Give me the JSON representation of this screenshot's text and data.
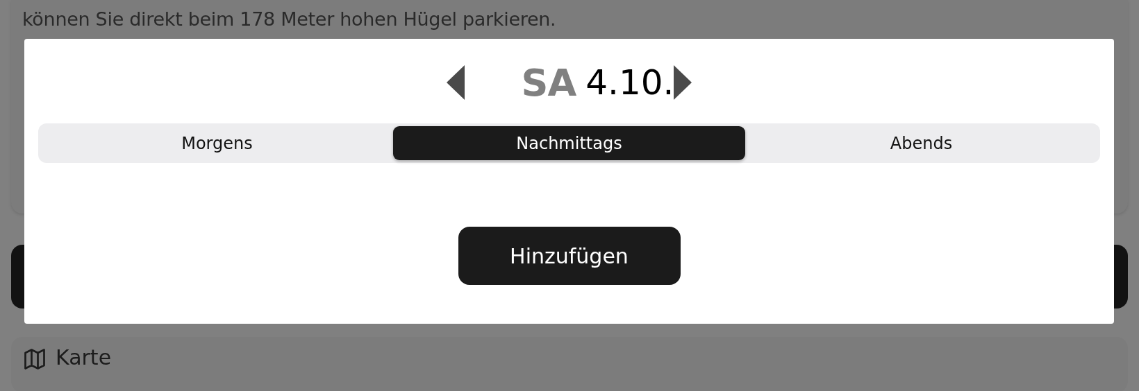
{
  "background": {
    "card_text": "können Sie direkt beim 178 Meter hohen Hügel parkieren.",
    "map_section": {
      "title": "Karte"
    }
  },
  "dialog": {
    "weekday": "SA",
    "date": "4.10.",
    "segments": [
      {
        "label": "Morgens",
        "selected": false
      },
      {
        "label": "Nachmittags",
        "selected": true
      },
      {
        "label": "Abends",
        "selected": false
      }
    ],
    "button": "Hinzufügen"
  }
}
